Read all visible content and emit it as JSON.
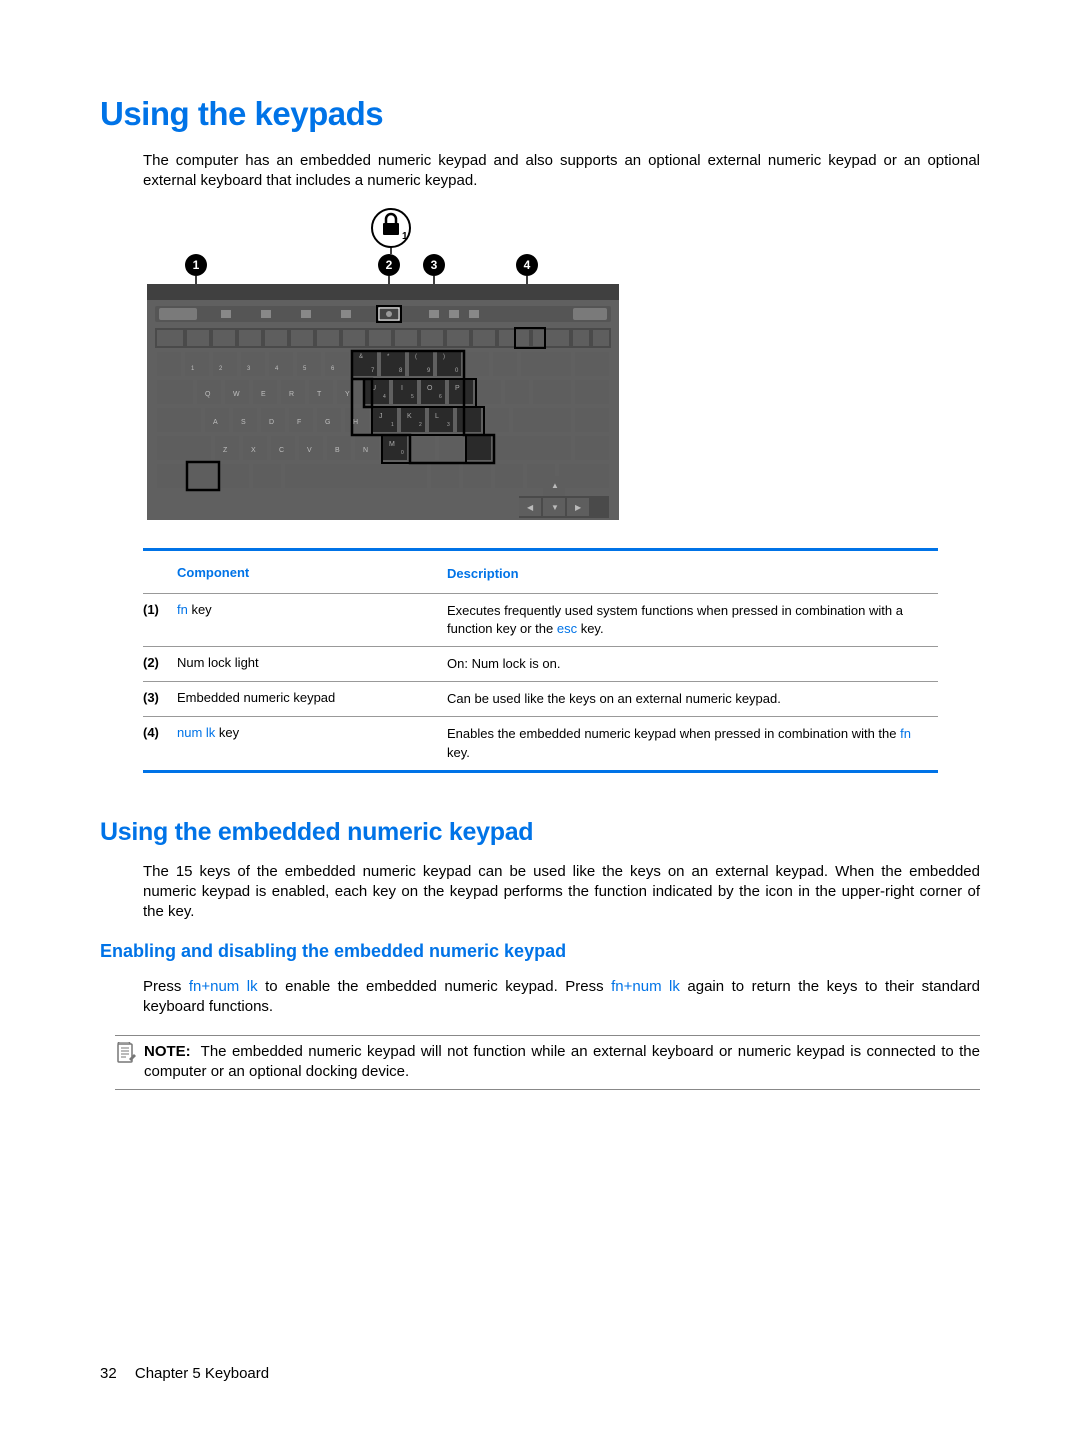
{
  "headings": {
    "main": "Using the keypads",
    "section": "Using the embedded numeric keypad",
    "subsection": "Enabling and disabling the embedded numeric keypad"
  },
  "intro": "The computer has an embedded numeric keypad and also supports an optional external numeric keypad or an optional external keyboard that includes a numeric keypad.",
  "table": {
    "headers": {
      "component": "Component",
      "description": "Description"
    },
    "rows": [
      {
        "idx": "(1)",
        "component_html": "<span class='link'>fn</span> key",
        "description_html": "Executes frequently used system functions when pressed in combination with a function key or the <span class='link'>esc</span> key."
      },
      {
        "idx": "(2)",
        "component_html": "Num lock light",
        "description_html": "On: Num lock is on."
      },
      {
        "idx": "(3)",
        "component_html": "Embedded numeric keypad",
        "description_html": "Can be used like the keys on an external numeric keypad."
      },
      {
        "idx": "(4)",
        "component_html": "<span class='link'>num lk</span> key",
        "description_html": "Enables the embedded numeric keypad when pressed in combination with the <span class='link'>fn</span> key."
      }
    ]
  },
  "section_body": "The 15 keys of the embedded numeric keypad can be used like the keys on an external keypad. When the embedded numeric keypad is enabled, each key on the keypad performs the function indicated by the icon in the upper-right corner of the key.",
  "subsection_body_html": "Press <span class='link'>fn+num lk</span> to enable the embedded numeric keypad. Press <span class='link'>fn+num lk</span> again to return the keys to their standard keyboard functions.",
  "note": {
    "label": "NOTE:",
    "text": "The embedded numeric keypad will not function while an external keyboard or numeric keypad is connected to the computer or an optional docking device."
  },
  "footer": {
    "page_number": "32",
    "chapter": "Chapter 5   Keyboard"
  },
  "figure": {
    "callouts": [
      "1",
      "2",
      "3",
      "4"
    ],
    "icon_label": "lock-1-icon"
  }
}
